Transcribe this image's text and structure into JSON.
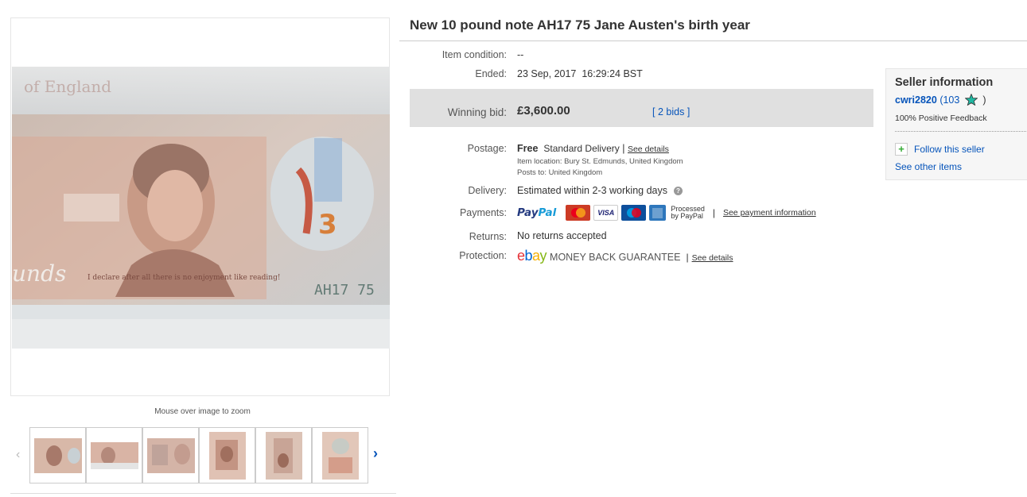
{
  "gallery": {
    "zoom_hint": "Mouse over image to zoom",
    "main_image_desc": "banknote photo",
    "note_serial": "AH17 75"
  },
  "listing": {
    "title": "New 10 pound note AH17 75 Jane Austen's birth year",
    "condition_label": "Item condition:",
    "condition_value": "--",
    "ended_label": "Ended:",
    "ended_value": "23 Sep, 2017  16:29:24 BST",
    "winning_label": "Winning bid:",
    "winning_value": "£3,600.00",
    "bids_prefix": "[",
    "bids_link": "2 bids",
    "bids_suffix": "]",
    "postage_label": "Postage:",
    "postage_free": "Free",
    "postage_method": "Standard Delivery",
    "postage_sep": "|",
    "postage_details": "See details",
    "item_location": "Item location:  Bury St. Edmunds, United Kingdom",
    "posts_to": "Posts to:  United Kingdom",
    "delivery_label": "Delivery:",
    "delivery_value": "Estimated within 2-3 working days",
    "payments_label": "Payments:",
    "paypal_p1": "Pay",
    "paypal_p2": "Pal",
    "processed_1": "Processed",
    "processed_2": "by PayPal",
    "payments_sep": "|",
    "payment_info": "See payment information",
    "returns_label": "Returns:",
    "returns_value": "No returns accepted",
    "protection_label": "Protection:",
    "ebay_e": "e",
    "ebay_b": "b",
    "ebay_a": "a",
    "ebay_y": "y",
    "mbg": "MONEY BACK GUARANTEE",
    "protection_sep": "|",
    "protection_details": "See details"
  },
  "seller": {
    "title": "Seller information",
    "name": "cwri2820",
    "score_open": "(103",
    "score_close": ")",
    "feedback": "100% Positive Feedback",
    "follow": "Follow this seller",
    "other_items": "See other items"
  },
  "colors": {
    "link": "#0654ba",
    "bid_box": "#e0e0e0",
    "star": "#1fb8a2"
  }
}
